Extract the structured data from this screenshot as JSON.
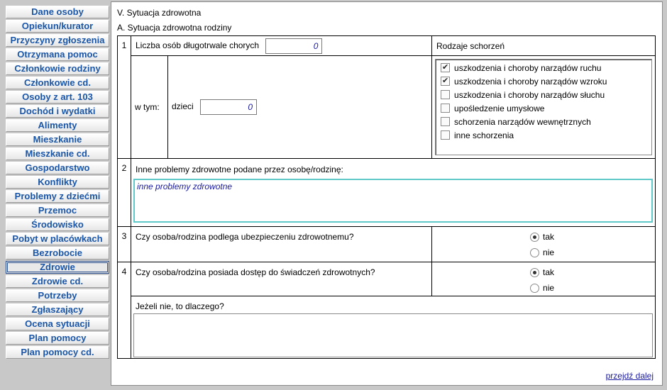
{
  "sidebar": {
    "items": [
      {
        "label": "Dane osoby"
      },
      {
        "label": "Opiekun/kurator"
      },
      {
        "label": "Przyczyny zgłoszenia"
      },
      {
        "label": "Otrzymana pomoc"
      },
      {
        "label": "Członkowie rodziny"
      },
      {
        "label": "Członkowie cd."
      },
      {
        "label": "Osoby z art. 103"
      },
      {
        "label": "Dochód i wydatki"
      },
      {
        "label": "Alimenty"
      },
      {
        "label": "Mieszkanie"
      },
      {
        "label": "Mieszkanie cd."
      },
      {
        "label": "Gospodarstwo"
      },
      {
        "label": "Konflikty"
      },
      {
        "label": "Problemy z dziećmi"
      },
      {
        "label": "Przemoc"
      },
      {
        "label": "Środowisko"
      },
      {
        "label": "Pobyt w placówkach"
      },
      {
        "label": "Bezrobocie"
      },
      {
        "label": "Zdrowie"
      },
      {
        "label": "Zdrowie cd."
      },
      {
        "label": "Potrzeby"
      },
      {
        "label": "Zgłaszający"
      },
      {
        "label": "Ocena sytuacji"
      },
      {
        "label": "Plan pomocy"
      },
      {
        "label": "Plan pomocy cd."
      }
    ],
    "active": "Zdrowie"
  },
  "main": {
    "section_title": "V. Sytuacja zdrowotna",
    "subsection_title": "A. Sytuacja zdrowotna rodziny",
    "q1": {
      "number": "1",
      "label": "Liczba osób długotrwale chorych",
      "value": "0",
      "w_tym_label": "w tym:",
      "children_label": "dzieci",
      "children_value": "0",
      "diseases_header": "Rodzaje schorzeń",
      "diseases": [
        {
          "label": "uszkodzenia i choroby narządów ruchu",
          "checked": true
        },
        {
          "label": "uszkodzenia i choroby narządów wzroku",
          "checked": true
        },
        {
          "label": "uszkodzenia i choroby narządów słuchu",
          "checked": false
        },
        {
          "label": "upośledzenie umysłowe",
          "checked": false
        },
        {
          "label": "schorzenia narządów wewnętrznych",
          "checked": false
        },
        {
          "label": "inne schorzenia",
          "checked": false
        }
      ]
    },
    "q2": {
      "number": "2",
      "label": "Inne problemy zdrowotne podane przez osobę/rodzinę:",
      "value": "inne problemy zdrowotne"
    },
    "q3": {
      "number": "3",
      "label": "Czy osoba/rodzina podlega ubezpieczeniu zdrowotnemu?",
      "options": [
        {
          "label": "tak",
          "selected": true
        },
        {
          "label": "nie",
          "selected": false
        }
      ]
    },
    "q4": {
      "number": "4",
      "label": "Czy osoba/rodzina posiada dostęp do świadczeń zdrowotnych?",
      "options": [
        {
          "label": "tak",
          "selected": true
        },
        {
          "label": "nie",
          "selected": false
        }
      ],
      "followup_label": "Jeżeli nie, to dlaczego?",
      "followup_value": ""
    },
    "next_link": "przejdź dalej"
  },
  "colors": {
    "link": "#1a56a8",
    "input_text": "#1a1aa0",
    "focus_border": "#5fc8c8"
  }
}
